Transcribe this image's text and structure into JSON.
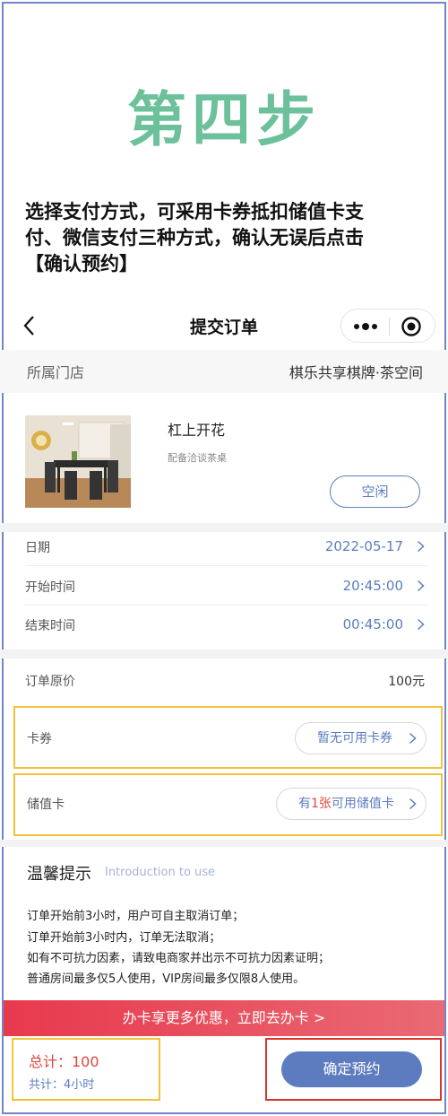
{
  "guide": {
    "step_title": "第四步",
    "instruction_line1": "选择支付方式，可采用卡券抵扣储值卡支",
    "instruction_line2": "付、微信支付三种方式，确认无误后点击",
    "instruction_line3": "【确认预约】"
  },
  "navbar": {
    "back_icon": "chevron-left-icon",
    "title": "提交订单",
    "more_icon": "more-dots-icon",
    "close_icon": "target-circle-icon"
  },
  "store": {
    "label": "所属门店",
    "value": "棋乐共享棋牌·茶空间"
  },
  "room": {
    "name": "杠上开花",
    "subtitle": "配备洽谈茶桌",
    "status": "空闲"
  },
  "schedule": [
    {
      "label": "日期",
      "value": "2022-05-17"
    },
    {
      "label": "开始时间",
      "value": "20:45:00"
    },
    {
      "label": "结束时间",
      "value": "00:45:00"
    }
  ],
  "price": {
    "label": "订单原价",
    "value": "100元"
  },
  "coupon": {
    "label": "卡券",
    "button": "暂无可用卡券"
  },
  "stored_card": {
    "label": "储值卡",
    "prefix": "有",
    "count": "1张",
    "suffix": "可用储值卡"
  },
  "tips": {
    "title": "温馨提示",
    "subtitle": "Introduction to use",
    "lines": [
      "订单开始前3小时，用户可自主取消订单；",
      "订单开始前3小时内，订单无法取消；",
      "如有不可抗力因素，请致电商家并出示不可抗力因素证明；",
      "普通房间最多仅5人使用，VIP房间最多仅限8人使用。"
    ]
  },
  "promo": {
    "text": "办卡享更多优惠，立即去办卡 >"
  },
  "footer": {
    "total": "总计：100",
    "duration": "共计：4小时",
    "confirm": "确定预约"
  },
  "colors": {
    "accent_blue": "#5c7ec0",
    "step_green": "#6cc19a",
    "highlight_yellow": "#f2c23a",
    "highlight_red": "#d9352a",
    "promo_red": "#e8394d"
  }
}
